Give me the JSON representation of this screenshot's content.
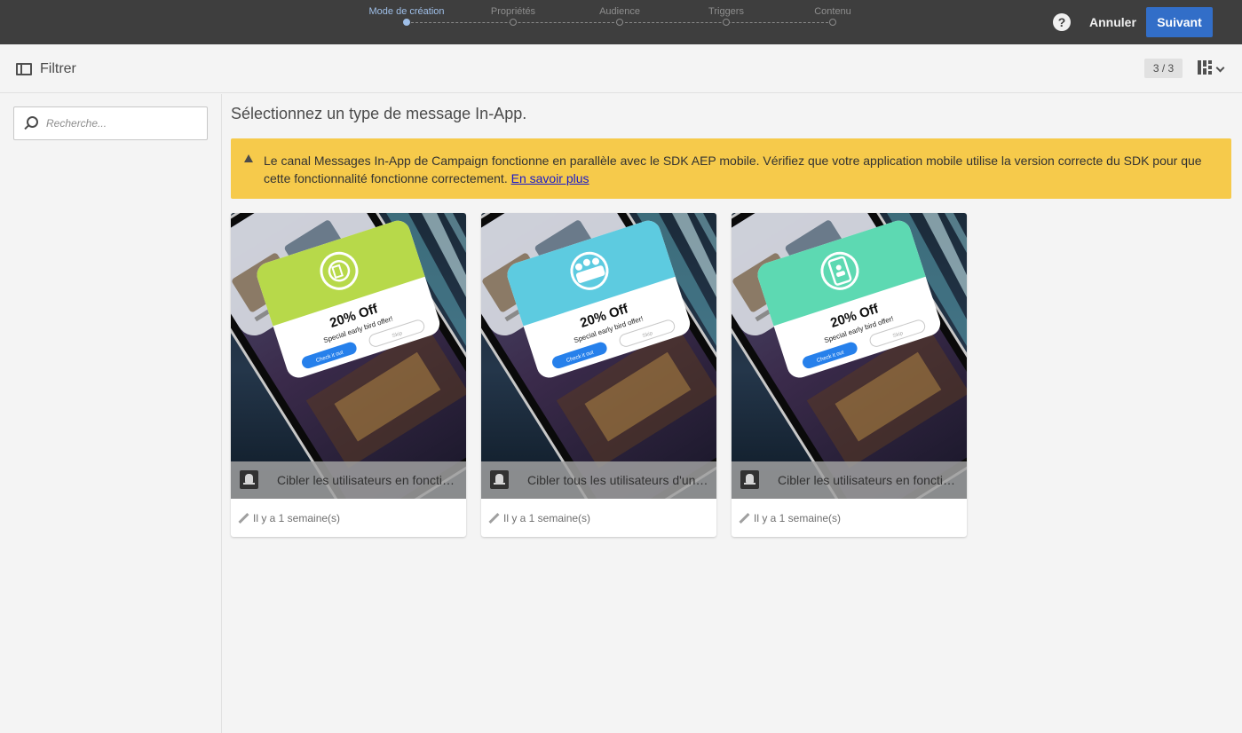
{
  "wizard": {
    "steps": [
      {
        "label": "Mode de création",
        "active": true
      },
      {
        "label": "Propriétés",
        "active": false
      },
      {
        "label": "Audience",
        "active": false
      },
      {
        "label": "Triggers",
        "active": false
      },
      {
        "label": "Contenu",
        "active": false
      }
    ],
    "help_icon": "help-icon",
    "cancel_label": "Annuler",
    "next_label": "Suivant",
    "accent_color": "#326ec8"
  },
  "toolbar": {
    "filter_label": "Filtrer",
    "filter_icon": "panel-toggle-icon",
    "pager": "3 / 3",
    "view_icon": "grid-view-icon"
  },
  "search": {
    "placeholder": "Recherche..."
  },
  "main": {
    "title": "Sélectionnez un type de message In-App.",
    "alert": {
      "text": "Le canal Messages In-App de Campaign fonctionne en parallèle avec le SDK AEP mobile. Vérifiez que votre application mobile utilise la version correcte du SDK pour que cette fonctionnalité fonctionne correctement.",
      "link_text": "En savoir plus",
      "color": "#f6ca4b"
    },
    "cards": [
      {
        "title": "Cibler les utilisateurs en fonction ...",
        "meta": "Il y a 1 semaine(s)",
        "accent": "#b7d94a",
        "icon": "target-icon"
      },
      {
        "title": "Cibler tous les utilisateurs d'une a...",
        "meta": "Il y a 1 semaine(s)",
        "accent": "#5dcbe0",
        "icon": "users-icon"
      },
      {
        "title": "Cibler les utilisateurs en fonction ...",
        "meta": "Il y a 1 semaine(s)",
        "accent": "#5dd9b2",
        "icon": "mobile-user-icon"
      }
    ],
    "promo": {
      "headline": "20% Off",
      "sub": "Special early bird offer!",
      "primary": "Check it out",
      "secondary": "Skip"
    }
  }
}
